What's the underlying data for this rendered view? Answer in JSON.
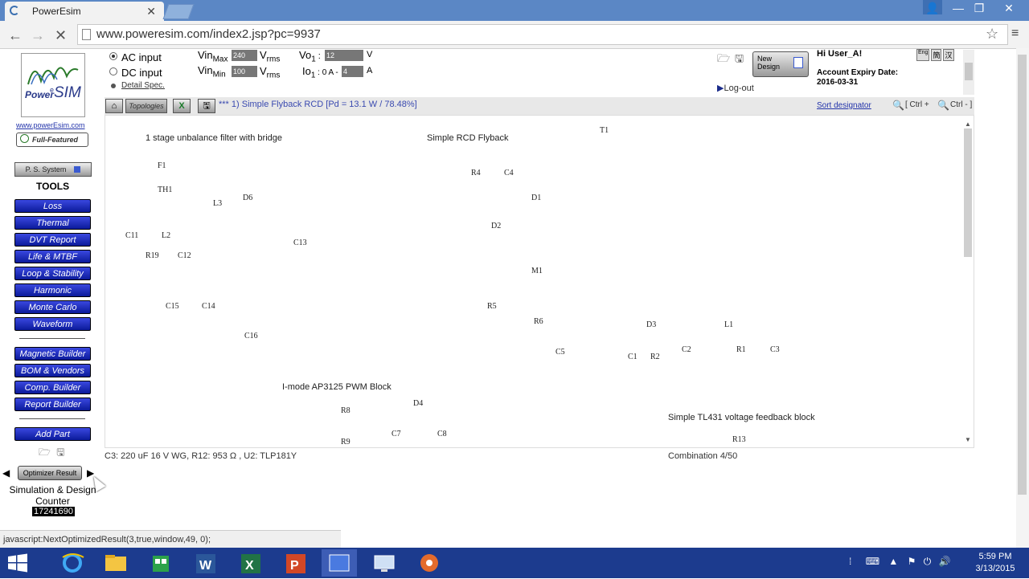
{
  "browser": {
    "tab_title": "PowerEsim",
    "tab_close": "✕",
    "url": "www.poweresim.com/index2.jsp?pc=9937",
    "nav": {
      "back": "←",
      "forward": "→",
      "reload": "✕"
    },
    "window_controls": {
      "user": "👤",
      "min": "—",
      "max": "❐",
      "close": "✕"
    }
  },
  "left_panel": {
    "logo": {
      "power": "Power",
      "e": "e",
      "sim": "SIM"
    },
    "site_link": "www.powerEsim.com",
    "badge": "Full-Featured",
    "ps_system": "P. S. System",
    "tools_title": "TOOLS",
    "tools": [
      "Loss",
      "Thermal",
      "DVT Report",
      "Life & MTBF",
      "Loop & Stability",
      "Harmonic",
      "Monte Carlo",
      "Waveform"
    ],
    "builders": [
      "Magnetic Builder",
      "BOM & Vendors",
      "Comp. Builder",
      "Report Builder"
    ],
    "add_part": "Add Part",
    "optimizer_result": "Optimizer Result",
    "prev": "◀",
    "next": "▶",
    "sim_counter_label": "Simulation & Design Counter",
    "counter_value": "17241690"
  },
  "spec": {
    "ac_input": "AC input",
    "dc_input": "DC input",
    "detail_spec": "Detail Spec.",
    "vin_max_label": "Vin",
    "vin_max_sub": "Max",
    "vin_max": "240",
    "vin_min_label": "Vin",
    "vin_min_sub": "Min",
    "vin_min": "100",
    "vrms": "V",
    "rms": "rms",
    "vo_label": "Vo",
    "vo_sub": "1",
    "vo_colon": " :",
    "vo_value": "12",
    "vo_unit": "V",
    "io_label": "Io",
    "io_sub": "1",
    "io_range": " : 0 A -",
    "io_value": "4",
    "io_unit": "A"
  },
  "header_right": {
    "new_design": "New Design",
    "logout": "Log-out",
    "greeting": "Hi User_A!",
    "expiry_label": "Account Expiry Date:",
    "expiry_date": "2016-03-31",
    "lang": [
      "Eng",
      "簡",
      "汉"
    ]
  },
  "toolbar": {
    "topologies": "Topologies",
    "title": "*** 1) Simple Flyback RCD [Pd = 13.1 W / 78.48%]",
    "sort": "Sort designator",
    "zoom_in": "[ Ctrl +",
    "zoom_out": "Ctrl - ]"
  },
  "schematic": {
    "blocks": {
      "filter": "1 stage unbalance filter with bridge",
      "flyback": "Simple RCD Flyback",
      "pwm": "I-mode AP3125 PWM Block",
      "feedback": "Simple TL431 voltage feedback block"
    },
    "labels": [
      "T1",
      "F1",
      "TH1",
      "L3",
      "D6",
      "C11",
      "L2",
      "R19",
      "C12",
      "C13",
      "C15",
      "C14",
      "C16",
      "R4",
      "C4",
      "D1",
      "D2",
      "M1",
      "R5",
      "R6",
      "C5",
      "D3",
      "L1",
      "C1",
      "R2",
      "C2",
      "R1",
      "C3",
      "R8",
      "D4",
      "C7",
      "C8",
      "R9",
      "R13"
    ]
  },
  "status_line": "C3: 220 uF 16 V WG, R12: 953 Ω , U2: TLP181Y",
  "combination": "Combination 4/50",
  "statusbar": "javascript:NextOptimizedResult(3,true,window,49, 0);",
  "taskbar": {
    "time": "5:59 PM",
    "date": "3/13/2015"
  },
  "colors": {
    "title_bar": "#5b87c5",
    "tool_button": "#1a2bd0",
    "taskbar": "#1c3b8e"
  }
}
